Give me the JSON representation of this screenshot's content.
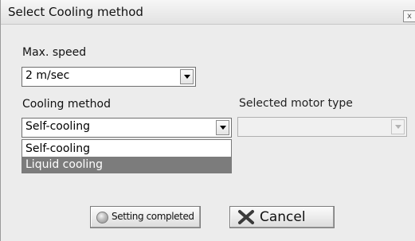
{
  "window": {
    "title": "Select Cooling method",
    "close_label": "x"
  },
  "max_speed": {
    "label": "Max. speed",
    "value": "2 m/sec"
  },
  "cooling_method": {
    "label": "Cooling method",
    "value": "Self-cooling",
    "options": [
      {
        "label": "Self-cooling",
        "selected": false
      },
      {
        "label": "Liquid cooling",
        "selected": true
      }
    ]
  },
  "motor_type": {
    "label": "Selected motor type",
    "value": "",
    "enabled": false
  },
  "buttons": {
    "setting_completed": "Setting completed",
    "cancel": "Cancel"
  },
  "icons": {
    "setting_completed": "radio-dot-icon",
    "cancel": "x-icon"
  },
  "colors": {
    "highlight": "#7c7c7c",
    "dialog_bg": "#ececec",
    "cancel_x": "#3a3a3a"
  }
}
